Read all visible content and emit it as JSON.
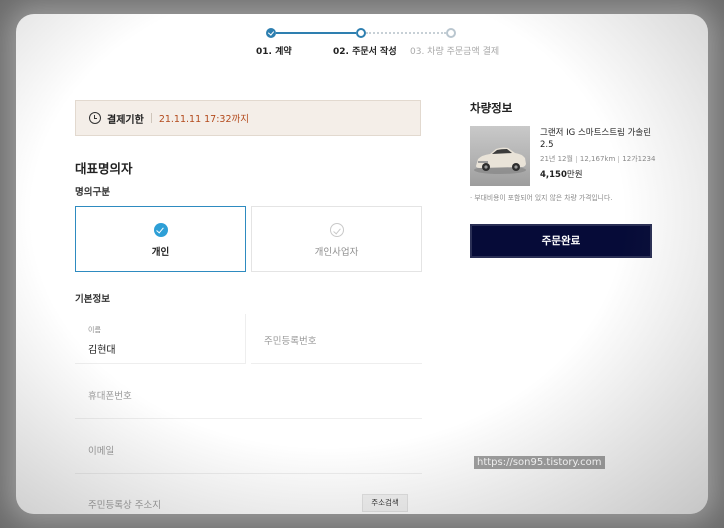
{
  "stepper": {
    "steps": [
      {
        "label": "01. 계약",
        "state": "done"
      },
      {
        "label": "02. 주문서 작성",
        "state": "current"
      },
      {
        "label": "03. 차량 주문금액 결제",
        "state": "todo"
      }
    ],
    "accent_color": "#2e7fb0"
  },
  "deadline": {
    "icon": "clock-icon",
    "label": "결제기한",
    "value": "21.11.11 17:32까지"
  },
  "representative": {
    "title": "대표명의자",
    "type_title": "명의구분",
    "types": [
      {
        "label": "개인",
        "selected": true
      },
      {
        "label": "개인사업자",
        "selected": false
      }
    ]
  },
  "basic_info": {
    "title": "기본정보",
    "name_label": "이름",
    "name_value": "김현대",
    "rrn_placeholder": "주민등록번호",
    "phone_placeholder": "휴대폰번호",
    "email_placeholder": "이메일",
    "address_placeholder": "주민등록상 주소지",
    "address_search_label": "주소검색"
  },
  "vehicle": {
    "title": "차량정보",
    "name": "그랜저 IG 스마트스트림 가솔린 2.5",
    "year": "21년 12월",
    "mileage": "12,167km",
    "plate": "12가1234",
    "price_number": "4,150",
    "price_unit": "만원",
    "note": "부대비용이 포함되어 있지 않은 차량 가격입니다."
  },
  "complete_button": {
    "label": "주문완료",
    "color": "#060b38"
  },
  "watermark": "https://son95.tistory.com"
}
